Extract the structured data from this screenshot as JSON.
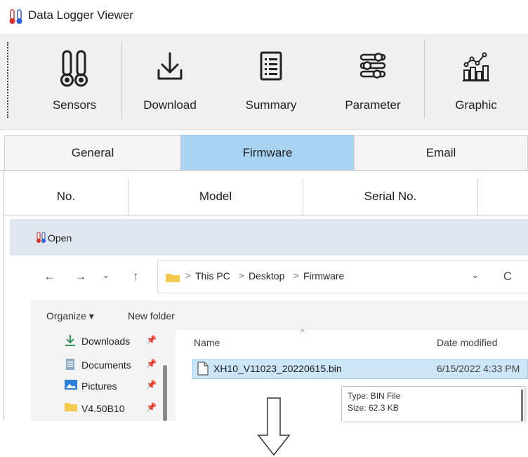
{
  "app": {
    "title": "Data Logger Viewer",
    "icon": "thermometers-icon"
  },
  "toolbar": {
    "buttons": [
      {
        "label": "Sensors",
        "icon": "sensors-icon"
      },
      {
        "label": "Download",
        "icon": "download-icon"
      },
      {
        "label": "Summary",
        "icon": "summary-icon"
      },
      {
        "label": "Parameter",
        "icon": "parameter-icon"
      },
      {
        "label": "Graphic",
        "icon": "graphic-icon"
      }
    ]
  },
  "tabs": [
    {
      "label": "General",
      "active": false
    },
    {
      "label": "Firmware",
      "active": true
    },
    {
      "label": "Email",
      "active": false
    }
  ],
  "table": {
    "columns": [
      "No.",
      "Model",
      "Serial No."
    ]
  },
  "open_dialog": {
    "title": "Open",
    "breadcrumb": [
      "This PC",
      "Desktop",
      "Firmware"
    ],
    "breadcrumb_sep": ">",
    "nav_glyphs": {
      "back": "←",
      "forward": "→",
      "history": "⌄",
      "up": "↑",
      "dropdown": "⌄",
      "refresh": "C"
    },
    "commands": {
      "organize": "Organize ▾",
      "new_folder": "New folder"
    },
    "nav_items": [
      {
        "label": "Downloads",
        "icon": "download-arrow-icon"
      },
      {
        "label": "Documents",
        "icon": "documents-icon"
      },
      {
        "label": "Pictures",
        "icon": "pictures-icon"
      },
      {
        "label": "V4.50B10",
        "icon": "folder-icon"
      }
    ],
    "pin_glyph": "📌",
    "columns": {
      "name": "Name",
      "date": "Date modified"
    },
    "files": [
      {
        "name": "XH10_V11023_20220615.bin",
        "date": "6/15/2022 4:33 PM"
      }
    ],
    "tooltip": {
      "type": "Type: BIN File",
      "size": "Size: 62.3 KB"
    }
  },
  "colors": {
    "tab_active": "#a8d4f2",
    "selection": "#cce5f7",
    "folder": "#f2c94c",
    "thermo_red": "#d9342b",
    "thermo_blue": "#2b5fd9"
  }
}
